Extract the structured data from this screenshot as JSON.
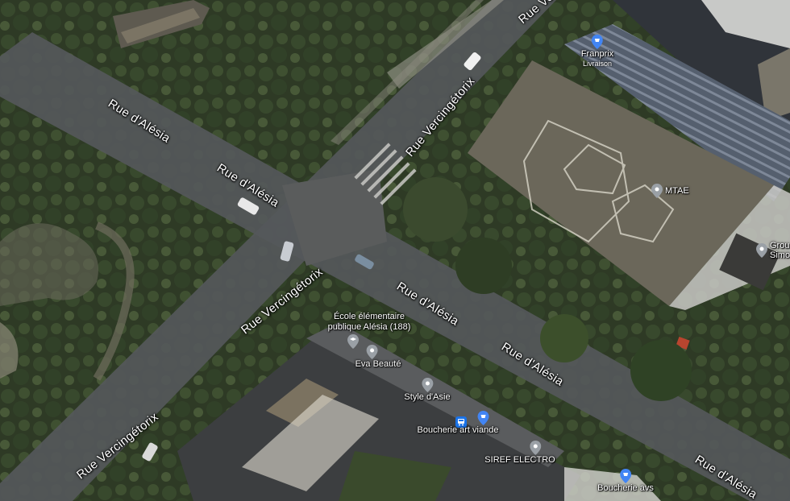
{
  "map": {
    "streets": [
      {
        "id": "alesia-1",
        "text": "Rue d'Alésia"
      },
      {
        "id": "alesia-2",
        "text": "Rue d'Alésia"
      },
      {
        "id": "alesia-3",
        "text": "Rue d'Alésia"
      },
      {
        "id": "alesia-4",
        "text": "Rue d'Alésia"
      },
      {
        "id": "alesia-5",
        "text": "Rue d'Alésia"
      },
      {
        "id": "verc-1",
        "text": "Rue Vercingétorix"
      },
      {
        "id": "verc-2",
        "text": "Rue Vercingétorix"
      },
      {
        "id": "verc-3",
        "text": "Rue Vercingétorix"
      }
    ],
    "pois": {
      "franprix": {
        "name": "Franprix",
        "sub": "Livraison",
        "icon": "shopping-pin-icon",
        "color": "#4285f4"
      },
      "mtae": {
        "name": "MTAE",
        "icon": "place-pin-icon",
        "color": "#9aa0a6"
      },
      "groupe": {
        "name": "Grou",
        "sub": "Simo",
        "icon": "place-pin-icon",
        "color": "#9aa0a6"
      },
      "ecole": {
        "name": "École élémentaire",
        "name2": "publique Alésia (188)",
        "icon": "school-pin-icon",
        "color": "#9aa0a6"
      },
      "eva": {
        "name": "Eva Beauté",
        "icon": "place-pin-icon",
        "color": "#9aa0a6"
      },
      "style": {
        "name": "Style d'Asie",
        "icon": "place-pin-icon",
        "color": "#9aa0a6"
      },
      "boucherie1": {
        "name": "Boucherie art viande",
        "icon": "shopping-pin-icon",
        "color": "#4285f4"
      },
      "bus": {
        "icon": "bus-stop-icon",
        "color": "#1a73e8"
      },
      "siref": {
        "name": "SIREF ELECTRO",
        "icon": "place-pin-icon",
        "color": "#9aa0a6"
      },
      "boucherie2": {
        "name": "Boucherie avs",
        "icon": "shopping-pin-icon",
        "color": "#4285f4"
      }
    }
  }
}
